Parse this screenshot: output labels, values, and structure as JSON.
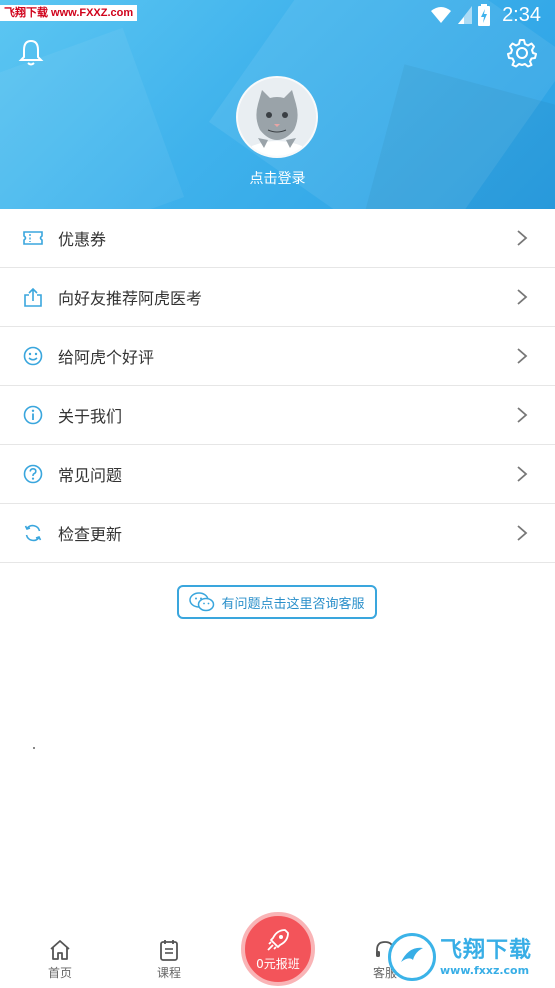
{
  "status_bar": {
    "watermark": "飞翔下载 www.FXXZ.com",
    "time": "2:34"
  },
  "header": {
    "login_label": "点击登录",
    "bell_icon": "bell-icon",
    "settings_icon": "gear-icon",
    "avatar_icon": "cat-avatar-icon"
  },
  "menu": {
    "items": [
      {
        "label": "优惠券",
        "icon": "ticket-icon"
      },
      {
        "label": "向好友推荐阿虎医考",
        "icon": "share-icon"
      },
      {
        "label": "给阿虎个好评",
        "icon": "smile-icon"
      },
      {
        "label": "关于我们",
        "icon": "info-icon"
      },
      {
        "label": "常见问题",
        "icon": "question-icon"
      },
      {
        "label": "检查更新",
        "icon": "refresh-icon"
      }
    ]
  },
  "consult_button": {
    "label": "有问题点击这里咨询客服",
    "icon": "wechat-icon"
  },
  "tabbar": {
    "home": "首页",
    "course": "课程",
    "signup": "0元报班",
    "service": "客服"
  },
  "watermark_bottom": {
    "title": "飞翔下载",
    "url": "www.fxxz.com"
  },
  "colors": {
    "header_blue": "#3fb2ec",
    "accent_blue": "#3aa6dd",
    "signup_red": "#f3545a"
  }
}
